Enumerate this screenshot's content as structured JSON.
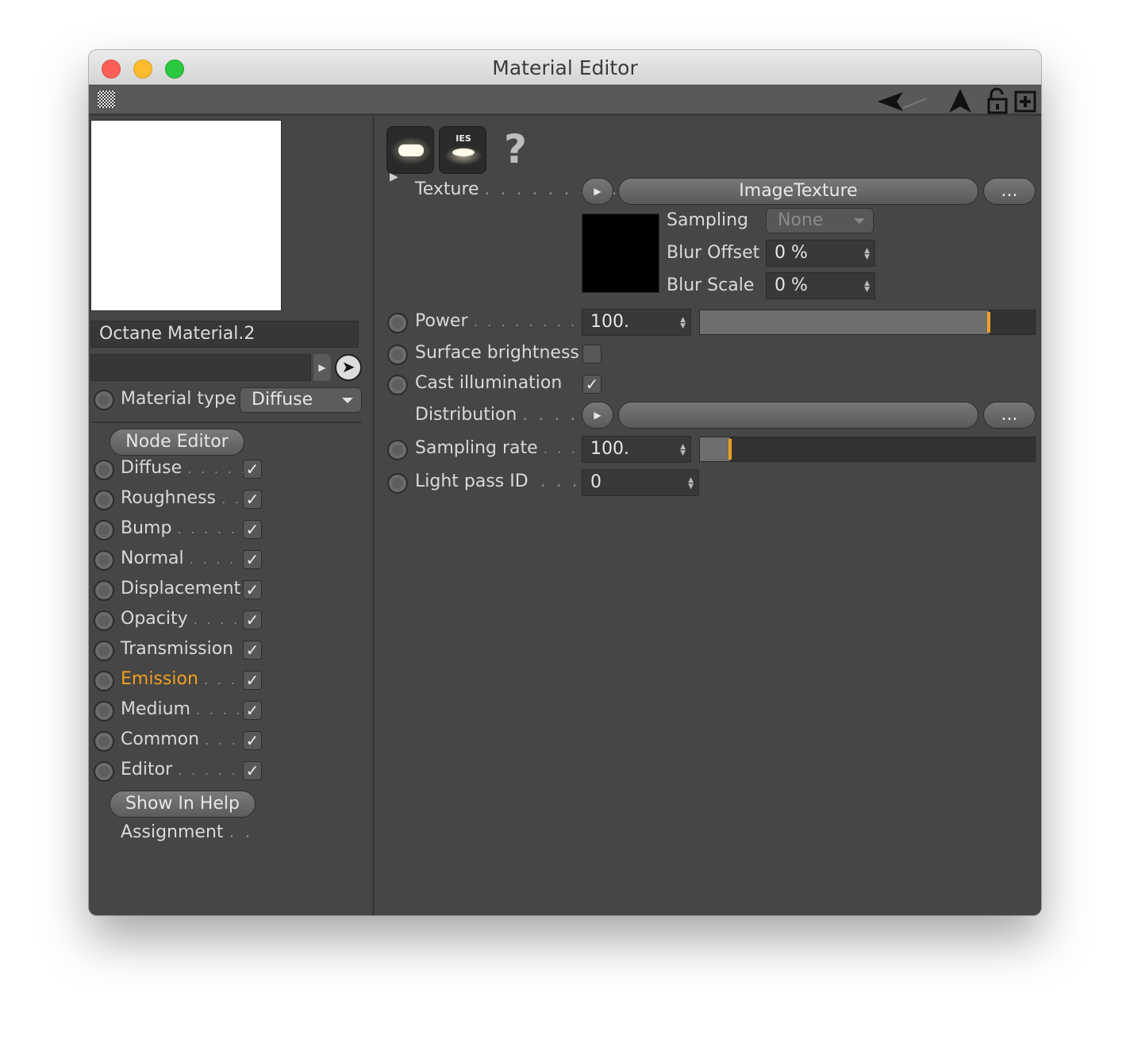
{
  "window": {
    "title": "Material Editor"
  },
  "toolbar": {
    "icons": [
      "grid-icon",
      "back-arrow-icon",
      "up-arrow-icon",
      "unlock-icon",
      "new-panel-icon"
    ]
  },
  "left": {
    "material_name": "Octane Material.2",
    "link_value": "",
    "material_type_label": "Material type",
    "material_type_value": "Diffuse",
    "node_editor_label": "Node Editor",
    "channels": [
      {
        "label": "Diffuse",
        "dots": ". . . . . .",
        "checked": true
      },
      {
        "label": "Roughness",
        "dots": ". .",
        "checked": true
      },
      {
        "label": "Bump",
        "dots": ". . . . . . .",
        "checked": true
      },
      {
        "label": "Normal",
        "dots": ". . . . . .",
        "checked": true
      },
      {
        "label": "Displacement",
        "dots": "",
        "checked": true
      },
      {
        "label": "Opacity",
        "dots": ". . . . .",
        "checked": true
      },
      {
        "label": "Transmission",
        "dots": "",
        "checked": true
      },
      {
        "label": "Emission",
        "dots": ". . . .",
        "checked": true,
        "active": true
      },
      {
        "label": "Medium",
        "dots": ". . . . .",
        "checked": true
      },
      {
        "label": "Common",
        "dots": ". . . .",
        "checked": true
      },
      {
        "label": "Editor",
        "dots": ". . . . . . .",
        "checked": true
      }
    ],
    "show_in_help_label": "Show In Help",
    "assignment_label": "Assignment",
    "assignment_dots": ". ."
  },
  "right": {
    "mode_buttons": {
      "ies_label": "IES",
      "help_label": "?"
    },
    "texture": {
      "label": "Texture",
      "dots": ". . . . . . . . .",
      "value": "ImageTexture",
      "more_label": "..."
    },
    "sampling": {
      "label": "Sampling",
      "value": "None"
    },
    "blur_offset": {
      "label": "Blur Offset",
      "value": "0 %"
    },
    "blur_scale": {
      "label": "Blur Scale",
      "value": "0 %"
    },
    "power": {
      "label": "Power",
      "dots": ". . . . . . . . . . .",
      "value": "100.",
      "slider_fraction": 1.0
    },
    "surface_brightness": {
      "label": "Surface brightness",
      "checked": false
    },
    "cast_illumination": {
      "label": "Cast illumination",
      "checked": true
    },
    "distribution": {
      "label": "Distribution",
      "dots": ". . . . .",
      "value": "",
      "more_label": "..."
    },
    "sampling_rate": {
      "label": "Sampling rate",
      "dots": ". . . .",
      "value": "100.",
      "slider_fraction": 0.1
    },
    "light_pass_id": {
      "label": "Light pass ID",
      "dots": ". . . .",
      "value": "0"
    }
  },
  "colors": {
    "accent": "#f0a020",
    "panel_bg": "#464646",
    "text": "#d9d9d9"
  }
}
